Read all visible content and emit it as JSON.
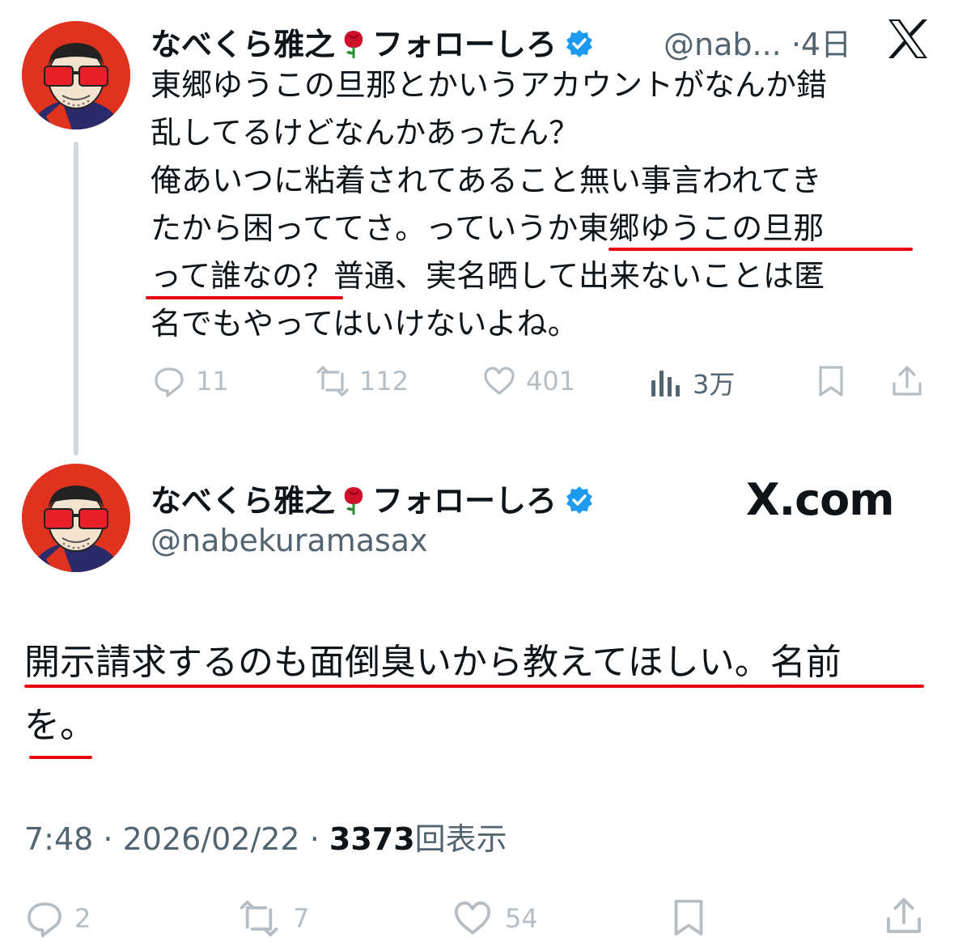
{
  "tweet1": {
    "display_name": "なべくら雅之",
    "name_suffix": "フォローしろ",
    "handle_truncated": "@nab...",
    "separator": "·",
    "time": "4日",
    "lines": [
      "東郷ゆうこの旦那とかいうアカウントがなんか錯",
      "乱してるけどなんかあったん？",
      "俺あいつに粘着されてあること無い事言われてき",
      "たから困っててさ。っていうか東郷ゆうこの旦那",
      "って誰なの？普通、実名晒して出来ないことは匿",
      "名でもやってはいけないよね。"
    ],
    "actions": {
      "replies": "11",
      "reposts": "112",
      "likes": "401",
      "views": "3万"
    }
  },
  "tweet2": {
    "display_name": "なべくら雅之",
    "name_suffix": "フォローしろ",
    "handle": "@nabekuramasax",
    "brand": "X.com",
    "lines": [
      "開示請求するのも面倒臭いから教えてほしい。名前",
      "を。"
    ],
    "time": "7:48",
    "date": "2026/02/22",
    "views_count": "3373",
    "views_label": "回表示",
    "actions": {
      "replies": "2",
      "reposts": "7",
      "likes": "54"
    }
  },
  "colors": {
    "underline": "#e60012",
    "verified": "#1d9bf0",
    "muted": "#536471",
    "avatar_bg": "#e0331f"
  },
  "icons": [
    "reply-icon",
    "repost-icon",
    "like-icon",
    "views-icon",
    "bookmark-icon",
    "share-icon",
    "x-logo-icon",
    "verified-badge-icon",
    "rose-icon"
  ]
}
